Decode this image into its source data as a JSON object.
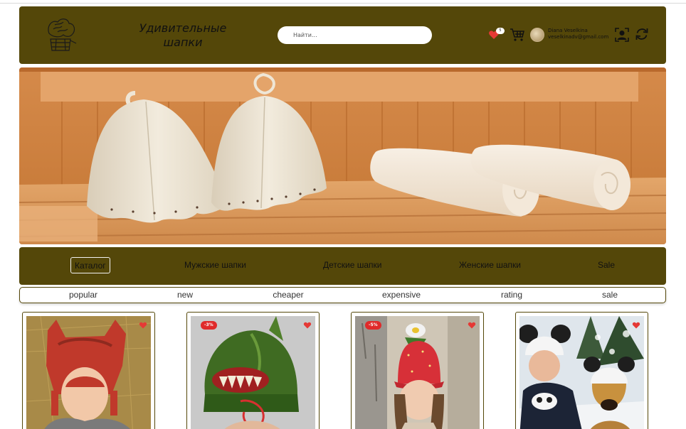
{
  "header": {
    "brand_line1": "Удивительные",
    "brand_line2": "шапки",
    "search_placeholder": "Найти...",
    "favorites_count": "5",
    "user_name": "Diana Veselkina",
    "user_email": "veselkinadv@gmail.com",
    "colors": {
      "bar": "#544709",
      "heart": "#e53935"
    },
    "icons": [
      "sauna-bucket-logo",
      "heart-icon",
      "cart-icon",
      "avatar",
      "profile-icon",
      "refresh-icon"
    ]
  },
  "categories": [
    {
      "label": "Каталог",
      "active": true
    },
    {
      "label": "Мужские шапки",
      "active": false
    },
    {
      "label": "Детские шапки",
      "active": false
    },
    {
      "label": "Женские шапки",
      "active": false
    },
    {
      "label": "Sale",
      "active": false
    }
  ],
  "sort": [
    "popular",
    "new",
    "cheaper",
    "expensive",
    "rating",
    "sale"
  ],
  "products": [
    {
      "discount": "",
      "image": "child in red felt hat on hay"
    },
    {
      "discount": "-3%",
      "image": "green monster felt hat"
    },
    {
      "discount": "-5%",
      "image": "girl in strawberry felt hat"
    },
    {
      "discount": "",
      "image": "man with dogs in panda hats in snow"
    }
  ]
}
